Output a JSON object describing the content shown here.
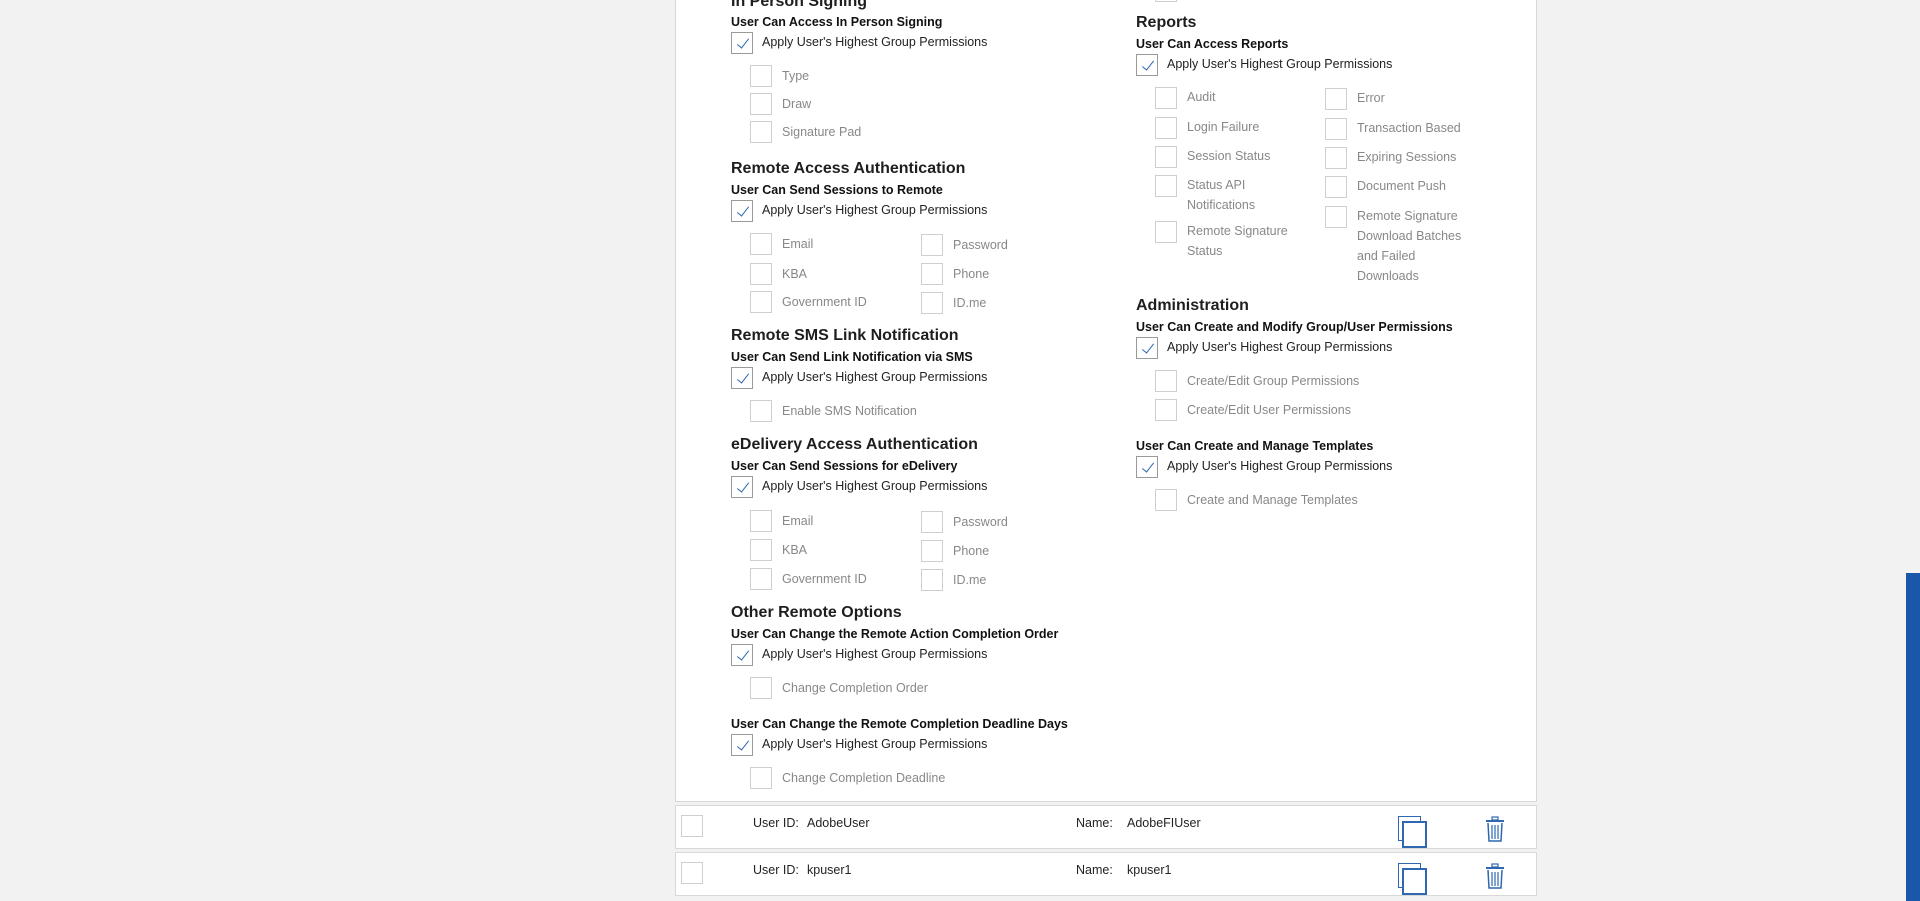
{
  "left": {
    "in_person": {
      "title": "In Person Signing",
      "sub": "User Can Access In Person Signing",
      "apply": "Apply User's Highest Group Permissions",
      "options": [
        "Type",
        "Draw",
        "Signature Pad"
      ]
    },
    "remote_auth": {
      "title": "Remote Access Authentication",
      "sub": "User Can Send Sessions to Remote",
      "apply": "Apply User's Highest Group Permissions",
      "col1": [
        "Email",
        "KBA",
        "Government ID"
      ],
      "col2": [
        "Password",
        "Phone",
        "ID.me"
      ]
    },
    "sms": {
      "title": "Remote SMS Link Notification",
      "sub": "User Can Send Link Notification via SMS",
      "apply": "Apply User's Highest Group Permissions",
      "options": [
        "Enable SMS Notification"
      ]
    },
    "edelivery": {
      "title": "eDelivery Access Authentication",
      "sub": "User Can Send Sessions for eDelivery",
      "apply": "Apply User's Highest Group Permissions",
      "col1": [
        "Email",
        "KBA",
        "Government ID"
      ],
      "col2": [
        "Password",
        "Phone",
        "ID.me"
      ]
    },
    "other": {
      "title": "Other Remote Options",
      "sub1": "User Can Change the Remote Action Completion Order",
      "apply1": "Apply User's Highest Group Permissions",
      "opt1": "Change Completion Order",
      "sub2": "User Can Change the Remote Completion Deadline Days",
      "apply2": "Apply User's Highest Group Permissions",
      "opt2": "Change Completion Deadline"
    }
  },
  "right": {
    "reports": {
      "title": "Reports",
      "sub": "User Can Access Reports",
      "apply": "Apply User's Highest Group Permissions",
      "col1": [
        "Audit",
        "Login Failure",
        "Session Status",
        "Status API Notifications",
        "Remote Signature Status"
      ],
      "col2": [
        "Error",
        "Transaction Based",
        "Expiring Sessions",
        "Document Push",
        "Remote Signature Download Batches and Failed Downloads"
      ]
    },
    "admin": {
      "title": "Administration",
      "sub": "User Can Create and Modify Group/User Permissions",
      "apply": "Apply User's Highest Group Permissions",
      "options": [
        "Create/Edit Group Permissions",
        "Create/Edit User Permissions"
      ]
    },
    "templates": {
      "sub": "User Can Create and Manage Templates",
      "apply": "Apply User's Highest Group Permissions",
      "options": [
        "Create and Manage Templates"
      ]
    }
  },
  "users": [
    {
      "id_label": "User ID:",
      "id": "AdobeUser",
      "name_label": "Name:",
      "name": "AdobeFIUser"
    },
    {
      "id_label": "User ID:",
      "id": "kpuser1",
      "name_label": "Name:",
      "name": "kpuser1"
    }
  ],
  "icons": {
    "copy": "copy-icon",
    "trash": "trash-icon"
  },
  "colors": {
    "accent": "#2f67b1",
    "scrollbar": "#1b57a8"
  }
}
